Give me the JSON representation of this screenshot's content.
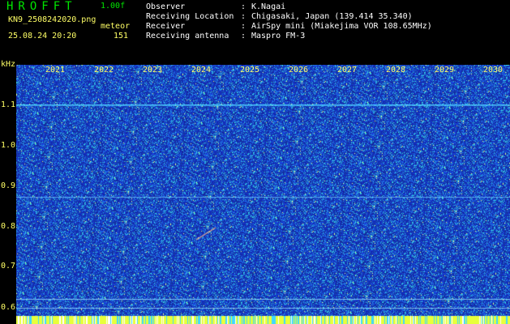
{
  "header": {
    "app_title": "HROFFT",
    "version": "1.00f",
    "filename": "KN9_2508242020.png",
    "mode": "meteor",
    "timestamp": "25.08.24 20:20",
    "count": "151"
  },
  "info": [
    {
      "key": "Observer",
      "value": "K.Nagai"
    },
    {
      "key": "Receiving Location",
      "value": "Chigasaki, Japan (139.414 35.340)"
    },
    {
      "key": "Receiver",
      "value": "AirSpy mini (Miakejima VOR 108.65MHz)"
    },
    {
      "key": "Receiving antenna",
      "value": "Maspro FM-3"
    }
  ],
  "axis": {
    "y_unit": "kHz",
    "y_ticks": [
      "1.1",
      "1.0",
      "0.9",
      "0.8",
      "0.7",
      "0.6"
    ],
    "x_labels": [
      "2021",
      "2022",
      "2023",
      "2024",
      "2025",
      "2026",
      "2027",
      "2028",
      "2029",
      "2030"
    ]
  },
  "colors": {
    "background": "#000000",
    "spectrogram_base": "#1a2fb4",
    "header_green": "#00e600",
    "label_yellow": "#ffff66",
    "carrier_line": "#4fd0ff"
  }
}
